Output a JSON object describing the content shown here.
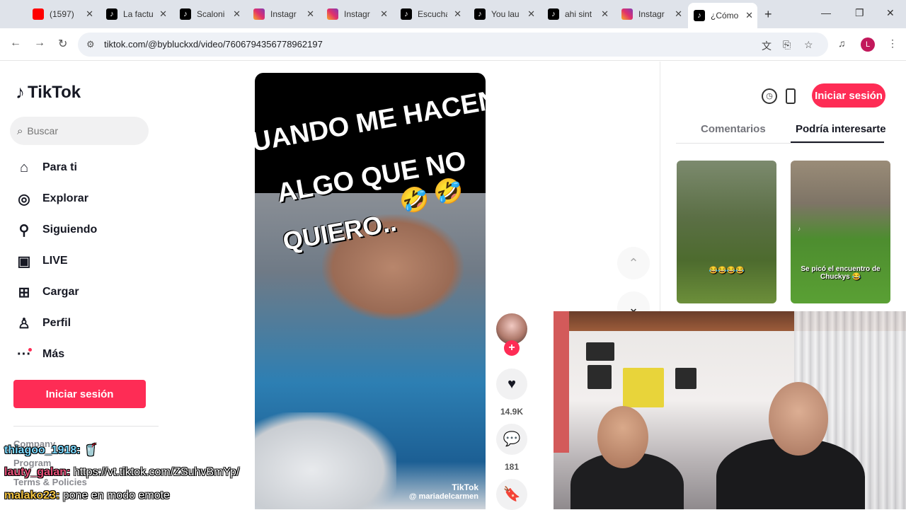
{
  "browser": {
    "tabs": [
      {
        "icon": "youtube",
        "title": "(1597)"
      },
      {
        "icon": "tiktok",
        "title": "La factu"
      },
      {
        "icon": "tiktok",
        "title": "Scaloni"
      },
      {
        "icon": "instagram",
        "title": "Instagr"
      },
      {
        "icon": "instagram",
        "title": "Instagr"
      },
      {
        "icon": "tiktok",
        "title": "Escucha"
      },
      {
        "icon": "tiktok",
        "title": "You lau"
      },
      {
        "icon": "tiktok",
        "title": "ahi sint"
      },
      {
        "icon": "instagram",
        "title": "Instagr"
      },
      {
        "icon": "tiktok",
        "title": "¿Cómo"
      }
    ],
    "url": "tiktok.com/@bybluckxd/video/7606794356778962197",
    "profile_initial": "L"
  },
  "sidebar": {
    "logo": "TikTok",
    "search_placeholder": "Buscar",
    "nav": [
      {
        "label": "Para ti",
        "icon": "home-icon"
      },
      {
        "label": "Explorar",
        "icon": "compass-icon"
      },
      {
        "label": "Siguiendo",
        "icon": "following-icon"
      },
      {
        "label": "LIVE",
        "icon": "live-icon"
      },
      {
        "label": "Cargar",
        "icon": "upload-icon"
      },
      {
        "label": "Perfil",
        "icon": "profile-icon"
      },
      {
        "label": "Más",
        "icon": "more-icon"
      }
    ],
    "login": "Iniciar sesión",
    "footer": [
      "Company",
      "Program",
      "Terms & Policies"
    ]
  },
  "video": {
    "caption_lines": [
      "UANDO ME HACEN",
      "ALGO QUE NO",
      "QUIERO.."
    ],
    "watermark_brand": "TikTok",
    "watermark_handle": "@ mariadelcarmen"
  },
  "actions": {
    "likes": "14.9K",
    "comments": "181"
  },
  "right_panel": {
    "login": "Iniciar sesión",
    "tabs": [
      "Comentarios",
      "Podría interesarte"
    ],
    "thumbs": [
      {
        "caption": "😂😂😂😂"
      },
      {
        "caption": "Se picó el encuentro de Chuckys 😂"
      }
    ]
  },
  "chat": [
    {
      "user": "thiagoo_1918:",
      "text": "🥤",
      "color": "#7ad9ff"
    },
    {
      "user": "lauty_galan:",
      "text": "https://vt.tiktok.com/ZSuhvBmYp/",
      "color": "#e8507a"
    },
    {
      "user": "malako23:",
      "text": "pone en modo emote",
      "color": "#f5c542"
    }
  ],
  "colors": {
    "accent": "#fe2c55",
    "tabbar": "#dfe3ea"
  }
}
